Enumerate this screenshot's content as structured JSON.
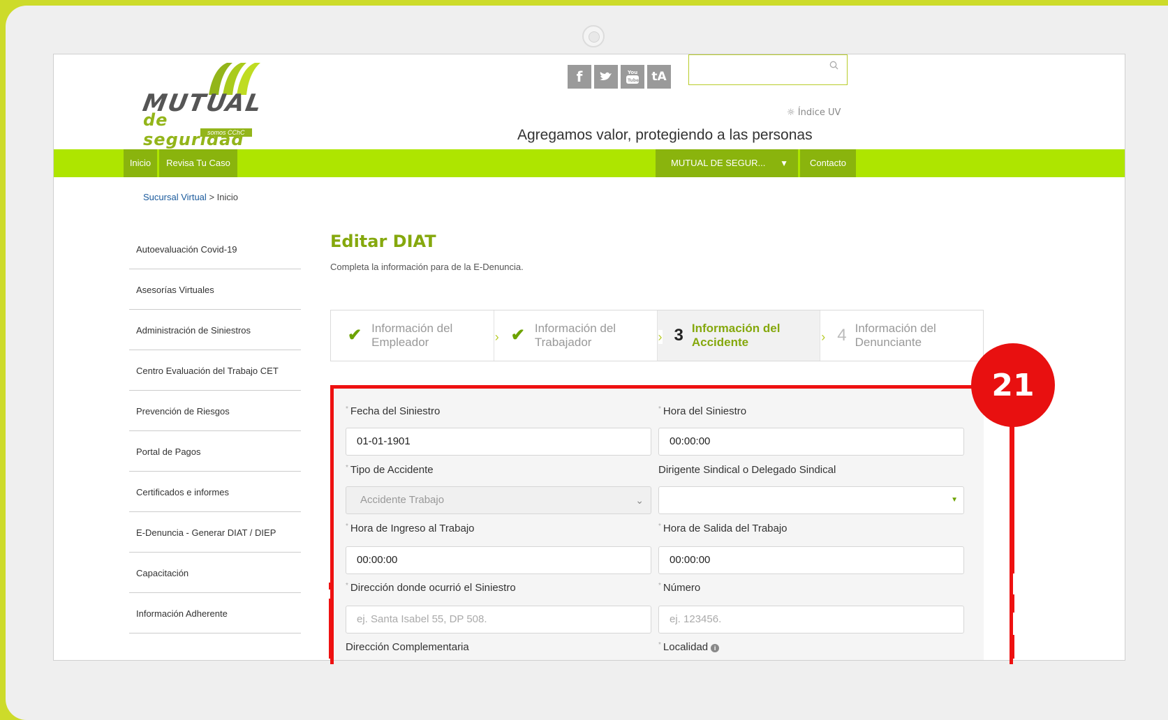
{
  "brand": {
    "name": "MUTUAL",
    "sub": "de seguridad",
    "tag": "somos CChC",
    "accent": "#aee500",
    "nav_dark": "#8ab40d",
    "title_color": "#85a80d"
  },
  "header": {
    "social": [
      {
        "icon": "facebook-icon",
        "glyph": "f"
      },
      {
        "icon": "twitter-icon",
        "glyph": "t"
      },
      {
        "icon": "youtube-icon",
        "glyph": "▶"
      },
      {
        "icon": "tripadvisor-icon",
        "glyph": "tA"
      }
    ],
    "search_placeholder": "",
    "uv_label": "Índice UV",
    "tagline": "Agregamos valor, protegiendo a las personas"
  },
  "nav": {
    "inicio": "Inicio",
    "revisa": "Revisa Tu Caso",
    "dropdown": "MUTUAL DE SEGUR...",
    "contacto": "Contacto"
  },
  "breadcrumb": {
    "link": "Sucursal Virtual",
    "current": "> Inicio"
  },
  "sidebar": {
    "items": [
      "Autoevaluación Covid-19",
      "Asesorías Virtuales",
      "Administración de Siniestros",
      "Centro Evaluación del Trabajo CET",
      "Prevención de Riesgos",
      "Portal de Pagos",
      "Certificados e informes",
      "E-Denuncia - Generar DIAT / DIEP",
      "Capacitación",
      "Información Adherente"
    ]
  },
  "main": {
    "title": "Editar DIAT",
    "subtitle": "Completa la información para de la E-Denuncia."
  },
  "steps": [
    {
      "mark": "✔",
      "line1": "Información del",
      "line2": "Empleador",
      "status": "done"
    },
    {
      "mark": "✔",
      "line1": "Información del",
      "line2": "Trabajador",
      "status": "done"
    },
    {
      "mark": "3",
      "line1": "Información del",
      "line2": "Accidente",
      "status": "active"
    },
    {
      "mark": "4",
      "line1": "Información del",
      "line2": "Denunciante",
      "status": "pending"
    }
  ],
  "form": {
    "required_mark": "*",
    "fecha_label": "Fecha del Siniestro",
    "fecha_value": "01-01-1901",
    "hora_label": "Hora del Siniestro",
    "hora_value": "00:00:00",
    "tipo_label": "Tipo de Accidente",
    "tipo_value": "Accidente Trabajo",
    "dirigente_label": "Dirigente Sindical o Delegado Sindical",
    "dirigente_value": "",
    "ingreso_label": "Hora de Ingreso al Trabajo",
    "ingreso_value": "00:00:00",
    "salida_label": "Hora de Salida del Trabajo",
    "salida_value": "00:00:00",
    "direccion_label": "Dirección donde ocurrió el Siniestro",
    "direccion_placeholder": "ej. Santa Isabel 55, DP 508.",
    "numero_label": "Número",
    "numero_placeholder": "ej. 123456.",
    "complementaria_label": "Dirección Complementaria",
    "localidad_label": "Localidad"
  },
  "annotation": {
    "number": "21",
    "color": "#e81010"
  }
}
